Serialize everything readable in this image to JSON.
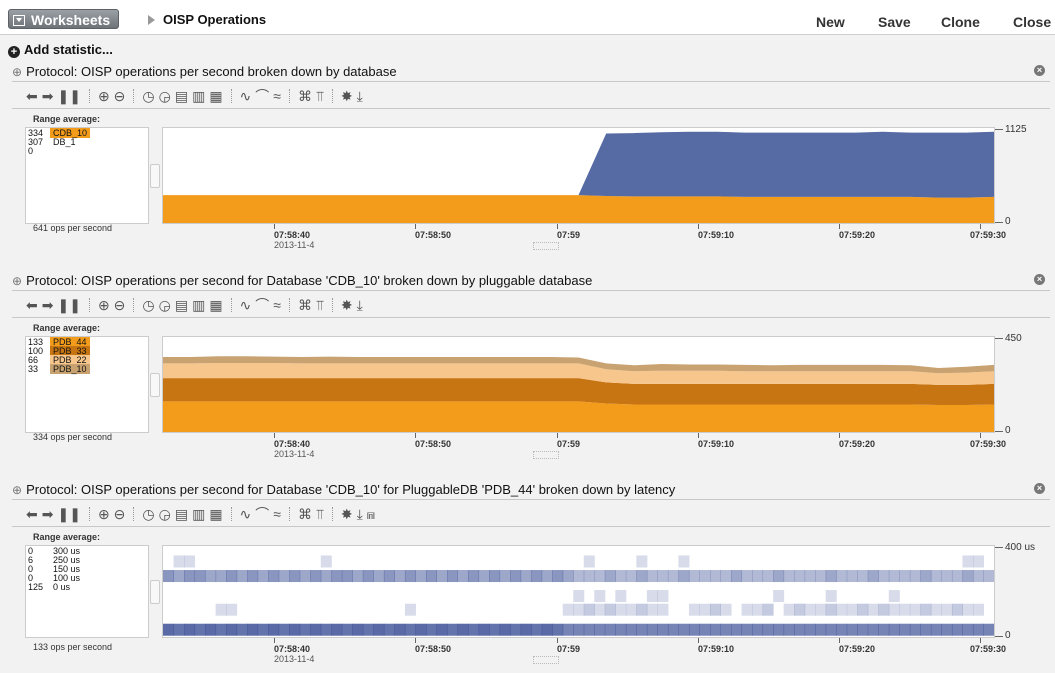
{
  "topbar": {
    "worksheets_label": "Worksheets",
    "crumb": "OISP Operations",
    "actions": [
      "New",
      "Save",
      "Clone",
      "Close"
    ]
  },
  "add_statistic": "Add statistic...",
  "panels": [
    {
      "title": "Protocol: OISP operations per second broken down by database",
      "range_label": "Range average:",
      "legend": [
        {
          "value": "334",
          "name": "CDB_10",
          "color": "#f39c1b"
        },
        {
          "value": "307",
          "name": "DB_1",
          "color": ""
        },
        {
          "value": "0",
          "name": "",
          "color": ""
        }
      ],
      "ops": "641 ops per second",
      "ymax": "1125",
      "ymin": "0",
      "ticks": [
        "07:58:40",
        "07:58:50",
        "07:59",
        "07:59:10",
        "07:59:20",
        "07:59:30"
      ],
      "date": "2013-11-4",
      "chart_data": {
        "type": "area",
        "stacked": true,
        "ylim": [
          0,
          1125
        ],
        "x": [
          "07:58:30",
          "07:58:32",
          "07:58:34",
          "07:58:36",
          "07:58:38",
          "07:58:40",
          "07:58:42",
          "07:58:44",
          "07:58:46",
          "07:58:48",
          "07:58:50",
          "07:58:52",
          "07:58:54",
          "07:58:56",
          "07:58:58",
          "07:59:00",
          "07:59:02",
          "07:59:04",
          "07:59:06",
          "07:59:08",
          "07:59:10",
          "07:59:12",
          "07:59:14",
          "07:59:16",
          "07:59:18",
          "07:59:20",
          "07:59:22",
          "07:59:24",
          "07:59:26",
          "07:59:28",
          "07:59:30"
        ],
        "series": [
          {
            "name": "CDB_10",
            "color": "#f39c1b",
            "values": [
              330,
              330,
              330,
              330,
              330,
              330,
              330,
              330,
              330,
              330,
              330,
              330,
              330,
              330,
              330,
              330,
              320,
              315,
              315,
              315,
              315,
              310,
              310,
              310,
              310,
              310,
              310,
              310,
              300,
              300,
              310
            ]
          },
          {
            "name": "DB_1",
            "color": "#566aa3",
            "values": [
              0,
              0,
              0,
              0,
              0,
              0,
              0,
              0,
              0,
              0,
              0,
              0,
              0,
              0,
              0,
              0,
              740,
              750,
              760,
              765,
              765,
              760,
              760,
              760,
              760,
              760,
              770,
              760,
              770,
              770,
              770
            ]
          }
        ]
      }
    },
    {
      "title": "Protocol: OISP operations per second for Database 'CDB_10' broken down by pluggable database",
      "range_label": "Range average:",
      "legend": [
        {
          "value": "133",
          "name": "PDB_44",
          "color": "#f39c1b"
        },
        {
          "value": "100",
          "name": "PDB_33",
          "color": "#c77512"
        },
        {
          "value": "66",
          "name": "PDB_22",
          "color": "#f7c68c"
        },
        {
          "value": "33",
          "name": "PDB_10",
          "color": "#c8a270"
        }
      ],
      "ops": "334 ops per second",
      "ymax": "450",
      "ymin": "0",
      "ticks": [
        "07:58:40",
        "07:58:50",
        "07:59",
        "07:59:10",
        "07:59:20",
        "07:59:30"
      ],
      "date": "2013-11-4",
      "chart_data": {
        "type": "area",
        "stacked": true,
        "ylim": [
          0,
          450
        ],
        "x": [
          "07:58:30",
          "07:58:32",
          "07:58:34",
          "07:58:36",
          "07:58:38",
          "07:58:40",
          "07:58:42",
          "07:58:44",
          "07:58:46",
          "07:58:48",
          "07:58:50",
          "07:58:52",
          "07:58:54",
          "07:58:56",
          "07:58:58",
          "07:59:00",
          "07:59:02",
          "07:59:04",
          "07:59:06",
          "07:59:08",
          "07:59:10",
          "07:59:12",
          "07:59:14",
          "07:59:16",
          "07:59:18",
          "07:59:20",
          "07:59:22",
          "07:59:24",
          "07:59:26",
          "07:59:28",
          "07:59:30"
        ],
        "series": [
          {
            "name": "PDB_44",
            "color": "#f39c1b",
            "values": [
              145,
              145,
              145,
              145,
              145,
              145,
              145,
              145,
              145,
              145,
              145,
              145,
              145,
              145,
              145,
              145,
              135,
              130,
              130,
              130,
              130,
              130,
              130,
              130,
              130,
              130,
              130,
              130,
              128,
              128,
              130
            ]
          },
          {
            "name": "PDB_33",
            "color": "#c77512",
            "values": [
              110,
              110,
              110,
              110,
              110,
              110,
              110,
              110,
              110,
              110,
              110,
              110,
              110,
              110,
              110,
              110,
              100,
              98,
              98,
              98,
              98,
              98,
              98,
              98,
              98,
              98,
              98,
              98,
              95,
              95,
              98
            ]
          },
          {
            "name": "PDB_22",
            "color": "#f7c68c",
            "values": [
              70,
              70,
              72,
              72,
              72,
              70,
              70,
              70,
              70,
              70,
              70,
              70,
              70,
              70,
              70,
              70,
              62,
              60,
              62,
              62,
              62,
              60,
              60,
              60,
              60,
              60,
              60,
              60,
              55,
              58,
              60
            ]
          },
          {
            "name": "PDB_10",
            "color": "#c8a270",
            "values": [
              30,
              30,
              32,
              32,
              30,
              30,
              32,
              30,
              30,
              30,
              30,
              30,
              30,
              30,
              30,
              28,
              28,
              28,
              32,
              30,
              30,
              30,
              28,
              30,
              30,
              30,
              30,
              28,
              25,
              28,
              30
            ]
          }
        ]
      }
    },
    {
      "title": "Protocol: OISP operations per second for Database 'CDB_10' for PluggableDB 'PDB_44' broken down by latency",
      "range_label": "Range average:",
      "legend": [
        {
          "value": "0",
          "name": "300 us",
          "color": ""
        },
        {
          "value": "6",
          "name": "250 us",
          "color": ""
        },
        {
          "value": "0",
          "name": "150 us",
          "color": ""
        },
        {
          "value": "0",
          "name": "100 us",
          "color": ""
        },
        {
          "value": "125",
          "name": "0 us",
          "color": ""
        }
      ],
      "ops": "133 ops per second",
      "ymax": "400 us",
      "ymin": "0",
      "ticks": [
        "07:58:40",
        "07:58:50",
        "07:59",
        "07:59:10",
        "07:59:20",
        "07:59:30"
      ],
      "date": "2013-11-4",
      "chart_data": {
        "type": "heatmap",
        "rows": [
          "300 us",
          "250 us",
          "150 us",
          "100 us",
          "0 us"
        ],
        "row_values_us": [
          300,
          250,
          150,
          100,
          0
        ],
        "ylim": [
          0,
          400
        ],
        "cells": [
          [
            0,
            0.2,
            0.2,
            0,
            0,
            0,
            0,
            0,
            0,
            0,
            0,
            0,
            0,
            0,
            0,
            0.2,
            0,
            0,
            0,
            0,
            0,
            0,
            0,
            0,
            0,
            0,
            0,
            0,
            0,
            0,
            0,
            0,
            0,
            0,
            0,
            0,
            0,
            0,
            0,
            0,
            0.2,
            0,
            0,
            0,
            0,
            0.2,
            0,
            0,
            0,
            0.2,
            0,
            0,
            0,
            0,
            0,
            0,
            0,
            0,
            0,
            0,
            0,
            0,
            0,
            0,
            0,
            0,
            0,
            0,
            0,
            0,
            0,
            0,
            0,
            0,
            0,
            0,
            0.2,
            0.2,
            0
          ],
          [
            0.6,
            0.5,
            0.6,
            0.6,
            0.5,
            0.5,
            0.6,
            0.5,
            0.6,
            0.5,
            0.6,
            0.5,
            0.6,
            0.5,
            0.6,
            0.5,
            0.6,
            0.6,
            0.5,
            0.6,
            0.5,
            0.6,
            0.5,
            0.6,
            0.5,
            0.6,
            0.5,
            0.6,
            0.5,
            0.6,
            0.5,
            0.6,
            0.5,
            0.6,
            0.5,
            0.6,
            0.5,
            0.6,
            0.5,
            0.4,
            0.4,
            0.4,
            0.5,
            0.4,
            0.4,
            0.5,
            0.4,
            0.4,
            0.4,
            0.5,
            0.4,
            0.4,
            0.4,
            0.4,
            0.5,
            0.4,
            0.4,
            0.4,
            0.5,
            0.4,
            0.4,
            0.4,
            0.4,
            0.5,
            0.4,
            0.4,
            0.4,
            0.5,
            0.4,
            0.4,
            0.4,
            0.4,
            0.5,
            0.4,
            0.4,
            0.4,
            0.5,
            0.4,
            0.4
          ],
          [
            0,
            0,
            0,
            0,
            0,
            0,
            0,
            0,
            0,
            0,
            0,
            0,
            0,
            0,
            0,
            0,
            0,
            0,
            0,
            0,
            0,
            0,
            0,
            0,
            0,
            0,
            0,
            0,
            0,
            0,
            0,
            0,
            0,
            0,
            0,
            0,
            0,
            0,
            0,
            0.2,
            0,
            0.2,
            0,
            0.2,
            0,
            0,
            0.2,
            0.2,
            0,
            0,
            0,
            0,
            0,
            0,
            0,
            0,
            0,
            0,
            0.2,
            0,
            0,
            0,
            0,
            0.2,
            0,
            0,
            0,
            0,
            0,
            0.2,
            0,
            0,
            0,
            0,
            0,
            0,
            0,
            0,
            0
          ],
          [
            0,
            0,
            0,
            0,
            0,
            0.2,
            0.2,
            0,
            0,
            0,
            0,
            0,
            0,
            0,
            0,
            0,
            0,
            0,
            0,
            0,
            0,
            0,
            0,
            0.2,
            0,
            0,
            0,
            0,
            0,
            0,
            0,
            0,
            0,
            0,
            0,
            0,
            0,
            0,
            0.2,
            0.2,
            0.3,
            0.2,
            0.3,
            0.2,
            0.2,
            0.3,
            0.2,
            0.2,
            0,
            0,
            0.2,
            0.2,
            0.3,
            0.2,
            0,
            0.2,
            0.2,
            0.3,
            0,
            0.2,
            0.3,
            0.2,
            0.2,
            0.3,
            0.2,
            0.2,
            0.3,
            0.2,
            0.3,
            0.2,
            0.2,
            0.2,
            0.3,
            0.2,
            0.2,
            0.3,
            0.2,
            0.2,
            0
          ],
          [
            0.85,
            0.8,
            0.85,
            0.8,
            0.85,
            0.8,
            0.85,
            0.8,
            0.85,
            0.8,
            0.85,
            0.8,
            0.85,
            0.8,
            0.85,
            0.8,
            0.85,
            0.8,
            0.85,
            0.8,
            0.85,
            0.8,
            0.85,
            0.8,
            0.85,
            0.8,
            0.85,
            0.8,
            0.85,
            0.8,
            0.85,
            0.8,
            0.85,
            0.8,
            0.85,
            0.8,
            0.85,
            0.8,
            0.7,
            0.7,
            0.7,
            0.7,
            0.7,
            0.7,
            0.7,
            0.7,
            0.7,
            0.7,
            0.7,
            0.7,
            0.7,
            0.7,
            0.7,
            0.7,
            0.7,
            0.7,
            0.7,
            0.7,
            0.7,
            0.7,
            0.7,
            0.7,
            0.7,
            0.7,
            0.7,
            0.7,
            0.7,
            0.7,
            0.7,
            0.7,
            0.7,
            0.7,
            0.7,
            0.7,
            0.7,
            0.7,
            0.7,
            0.7,
            0.7
          ]
        ]
      }
    }
  ],
  "toolbar_icons": [
    [
      "back-icon",
      "forward-icon",
      "pause-icon"
    ],
    [
      "zoom-in-icon",
      "zoom-out-icon"
    ],
    [
      "time-back-icon",
      "time-forward-icon",
      "table-icon",
      "table-alt-icon",
      "grid-icon"
    ],
    [
      "line-chart-icon",
      "area-chart-icon",
      "stacked-chart-icon"
    ],
    [
      "collapse-icon",
      "drill-icon"
    ],
    [
      "palette-icon",
      "download-icon"
    ]
  ],
  "extra_toolbar_icon": "histogram-icon"
}
